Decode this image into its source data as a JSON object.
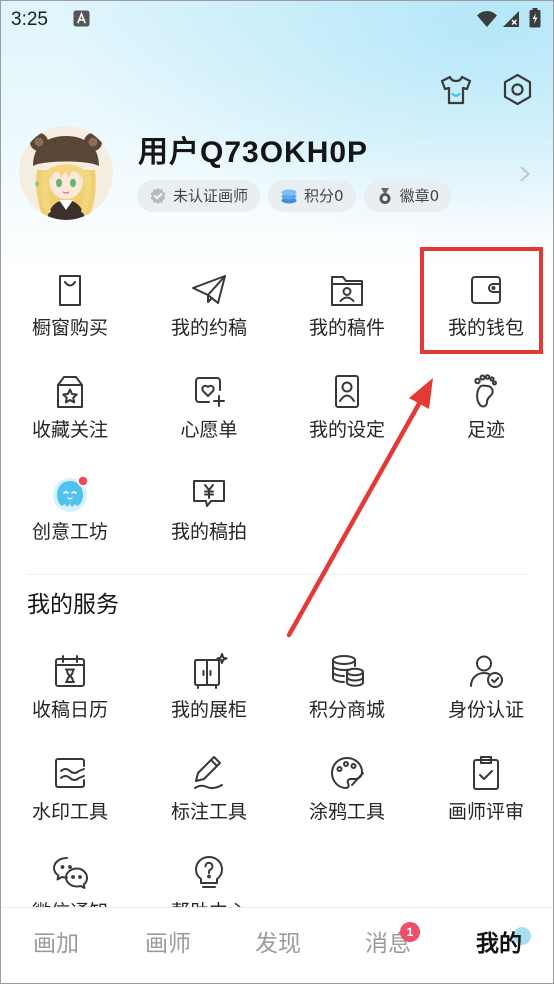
{
  "status_bar": {
    "time": "3:25",
    "icons": [
      "app-notification-icon",
      "wifi-icon",
      "signal-icon",
      "battery-charging-icon"
    ]
  },
  "header": {
    "icons": [
      "tshirt-icon",
      "settings-icon"
    ]
  },
  "profile": {
    "username": "用户Q73OKH0P",
    "badges": [
      {
        "label": "未认证画师",
        "icon": "verified-badge-icon"
      },
      {
        "label": "积分0",
        "icon": "coins-icon"
      },
      {
        "label": "徽章0",
        "icon": "medal-icon"
      }
    ],
    "chevron": "chevron-right-icon"
  },
  "quick_grid": [
    {
      "label": "橱窗购买",
      "icon": "shopping-bag-icon"
    },
    {
      "label": "我的约稿",
      "icon": "paper-plane-icon"
    },
    {
      "label": "我的稿件",
      "icon": "folder-user-icon"
    },
    {
      "label": "我的钱包",
      "icon": "wallet-icon",
      "highlighted": true
    },
    {
      "label": "收藏关注",
      "icon": "star-box-icon"
    },
    {
      "label": "心愿单",
      "icon": "heart-add-icon"
    },
    {
      "label": "我的设定",
      "icon": "profile-card-icon"
    },
    {
      "label": "足迹",
      "icon": "footprint-icon"
    },
    {
      "label": "创意工坊",
      "icon": "mascot-icon",
      "dot": true
    },
    {
      "label": "我的稿拍",
      "icon": "yen-bubble-icon"
    }
  ],
  "services": {
    "title": "我的服务",
    "items": [
      {
        "label": "收稿日历",
        "icon": "calendar-hourglass-icon"
      },
      {
        "label": "我的展柜",
        "icon": "cabinet-icon"
      },
      {
        "label": "积分商城",
        "icon": "coins-stack-icon"
      },
      {
        "label": "身份认证",
        "icon": "user-verified-icon"
      },
      {
        "label": "水印工具",
        "icon": "watermark-icon"
      },
      {
        "label": "标注工具",
        "icon": "pencil-icon"
      },
      {
        "label": "涂鸦工具",
        "icon": "palette-icon"
      },
      {
        "label": "画师评审",
        "icon": "clipboard-check-icon"
      },
      {
        "label": "微信通知",
        "icon": "wechat-icon"
      },
      {
        "label": "帮助中心",
        "icon": "help-bulb-icon"
      }
    ]
  },
  "bottom_nav": {
    "items": [
      {
        "label": "画加",
        "active": false
      },
      {
        "label": "画师",
        "active": false
      },
      {
        "label": "发现",
        "active": false
      },
      {
        "label": "消息",
        "active": false,
        "badge": "1"
      },
      {
        "label": "我的",
        "active": true
      }
    ]
  },
  "annotation": {
    "color": "#e53935"
  },
  "colors": {
    "header_tint": "#dff5fc",
    "text_primary": "#222222",
    "nav_inactive": "#9b9b9b",
    "nav_active": "#111111",
    "message_badge": "#f04e6a",
    "mascot_blue": "#4fc3ee",
    "annotation_red": "#e53935"
  }
}
